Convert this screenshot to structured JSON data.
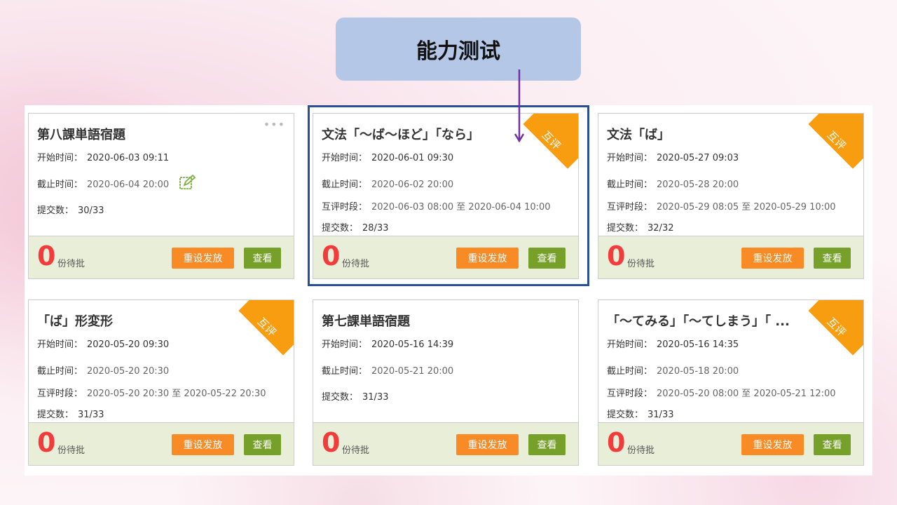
{
  "header": {
    "title": "能力测试"
  },
  "labels": {
    "start": "开始时间：",
    "end": "截止时间：",
    "peer": "互评时段：",
    "submit": "提交数：",
    "pending": "份待批",
    "reset": "重设发放",
    "view": "查看",
    "peer_badge": "互评",
    "more": "•••"
  },
  "cards": [
    {
      "title": "第八課単語宿題",
      "start": "2020-06-03 09:11",
      "end": "2020-06-04 20:00",
      "submitted": "30/33",
      "pending": "0"
    },
    {
      "title": "文法「～ば～ほど」「なら」",
      "start": "2020-06-01 09:30",
      "end": "2020-06-02 20:00",
      "peer": "2020-06-03 08:00 至 2020-06-04 10:00",
      "submitted": "28/33",
      "pending": "0"
    },
    {
      "title": "文法「ば」",
      "start": "2020-05-27 09:03",
      "end": "2020-05-28 20:00",
      "peer": "2020-05-29 08:05 至 2020-05-29 10:00",
      "submitted": "32/32",
      "pending": "0"
    },
    {
      "title": "「ば」形変形",
      "start": "2020-05-20 09:30",
      "end": "2020-05-20 20:30",
      "peer": "2020-05-20 20:30 至 2020-05-22 20:30",
      "submitted": "31/33",
      "pending": "0"
    },
    {
      "title": "第七課単語宿題",
      "start": "2020-05-16 14:39",
      "end": "2020-05-21 20:00",
      "submitted": "31/33",
      "pending": "0"
    },
    {
      "title": "「～てみる」「～てしまう」「 ...",
      "start": "2020-05-16 14:35",
      "end": "2020-05-18 20:00",
      "peer": "2020-05-20 08:00 至 2020-05-21 12:00",
      "submitted": "31/33",
      "pending": "0"
    }
  ]
}
